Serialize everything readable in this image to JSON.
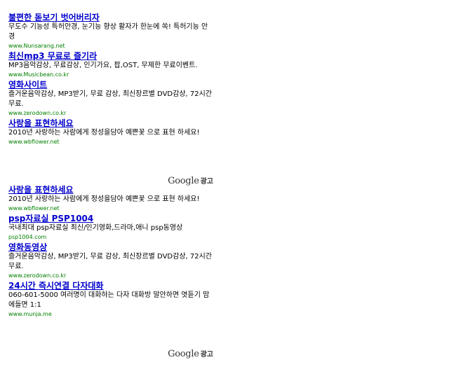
{
  "ad_units": [
    {
      "ads": [
        {
          "title": "불편한 돋보기 벗어버리자",
          "description": "무도수 기능성 특허안경, 눈기능 향상 활자가 한눈에 쏙! 특허기능 안경",
          "url": "www.Nunsarang.net"
        },
        {
          "title": "최신mp3 무료로 즐기라",
          "description": "MP3음악감상, 무료감상, 인기가요, 팝,OST, 무제한 무료이벤트.",
          "url": "www.Musicbean.co.kr"
        },
        {
          "title": "영화사이트",
          "description": "즐거운음악감상, MP3받기, 무료 감상, 최신장르별 DVD감상, 72시간무료.",
          "url": "www.zerodown.co.kr"
        },
        {
          "title": "사랑을 표현하세요",
          "description": "2010년 사랑하는 사람에게 정성을담아 예쁜꽃 으로 표현 하세요!",
          "url": "www.wbflower.net"
        }
      ],
      "footer": {
        "brand": "Google",
        "suffix": "광고"
      }
    },
    {
      "ads": [
        {
          "title": "사랑을 표현하세요",
          "description": "2010년 사랑하는 사람에게 정성을담아 예쁜꽃 으로 표현 하세요!",
          "url": "www.wbflower.net"
        },
        {
          "title": "psp자료실 PSP1004",
          "description": "국내최대 psp자료실 최신/인기영화,드라마,애니 psp동영상",
          "url": "psp1004.com"
        },
        {
          "title": "영화동영상",
          "description": "즐거운음악감상, MP3받기, 무료 감상, 최신장르별 DVD감상, 72시간무료.",
          "url": "www.zerodown.co.kr"
        },
        {
          "title": "24시간 즉시연결 다자대화",
          "description": "060-601-5000 여러명이 대화하는 다자 대화방 말안하면 엿듣기 맘에들면 1:1",
          "url": "www.munja.me"
        }
      ],
      "footer": {
        "brand": "Google",
        "suffix": "광고"
      }
    }
  ],
  "colors": {
    "title": "#0000cc",
    "url": "#008000",
    "text": "#000000",
    "background": "#ffffff"
  }
}
